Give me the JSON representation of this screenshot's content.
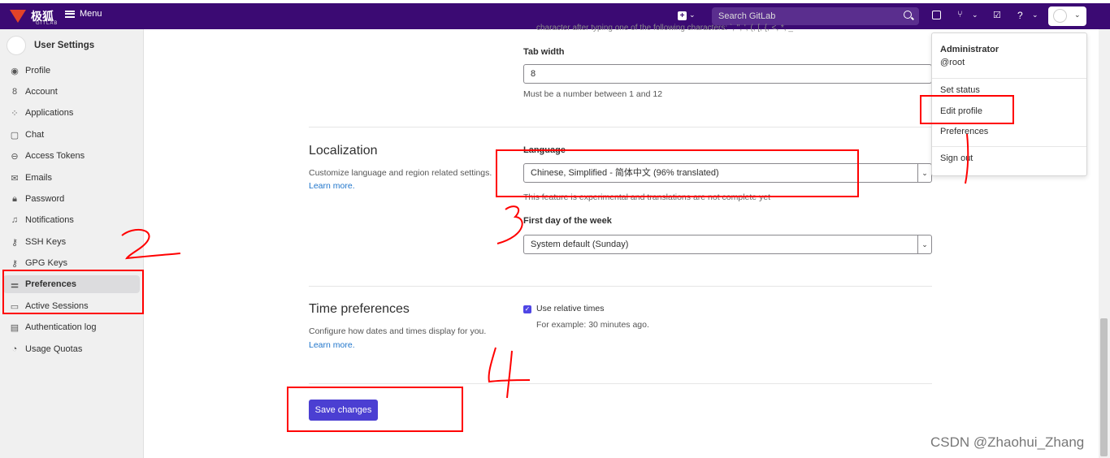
{
  "topbar": {
    "logo_text": "极狐",
    "logo_sub": "GITLAB",
    "menu_label": "Menu",
    "search_placeholder": "Search GitLab"
  },
  "sidebar": {
    "title": "User Settings",
    "items": [
      {
        "label": "Profile",
        "icon": "profile-icon"
      },
      {
        "label": "Account",
        "icon": "account-icon"
      },
      {
        "label": "Applications",
        "icon": "applications-icon"
      },
      {
        "label": "Chat",
        "icon": "chat-icon"
      },
      {
        "label": "Access Tokens",
        "icon": "token-icon"
      },
      {
        "label": "Emails",
        "icon": "mail-icon"
      },
      {
        "label": "Password",
        "icon": "lock-icon"
      },
      {
        "label": "Notifications",
        "icon": "bell-icon"
      },
      {
        "label": "SSH Keys",
        "icon": "key-icon"
      },
      {
        "label": "GPG Keys",
        "icon": "key-icon"
      },
      {
        "label": "Preferences",
        "icon": "preferences-icon"
      },
      {
        "label": "Active Sessions",
        "icon": "monitor-icon"
      },
      {
        "label": "Authentication log",
        "icon": "log-icon"
      },
      {
        "label": "Usage Quotas",
        "icon": "quota-icon"
      }
    ],
    "active_index": 10
  },
  "main": {
    "cut_text": "character after typing one of the following characters: `, \", ', (, [, {, <, *, _",
    "tab_width": {
      "label": "Tab width",
      "value": "8",
      "help": "Must be a number between 1 and 12"
    },
    "localization": {
      "title": "Localization",
      "description": "Customize language and region related settings.",
      "learn_more": "Learn more.",
      "language_label": "Language",
      "language_value": "Chinese, Simplified - 简体中文 (96% translated)",
      "language_help": "This feature is experimental and translations are not complete yet",
      "first_day_label": "First day of the week",
      "first_day_value": "System default (Sunday)"
    },
    "time": {
      "title": "Time preferences",
      "description": "Configure how dates and times display for you.",
      "learn_more": "Learn more.",
      "checkbox_label": "Use relative times",
      "checkbox_checked": true,
      "example": "For example: 30 minutes ago."
    },
    "save_label": "Save changes"
  },
  "dropdown": {
    "name": "Administrator",
    "username": "@root",
    "items": [
      "Set status",
      "Edit profile",
      "Preferences",
      "Sign out"
    ]
  },
  "annotations": {
    "numbers": [
      "1",
      "2",
      "3",
      "4"
    ],
    "color": "#ff0000"
  },
  "watermark": "CSDN @Zhaohui_Zhang"
}
